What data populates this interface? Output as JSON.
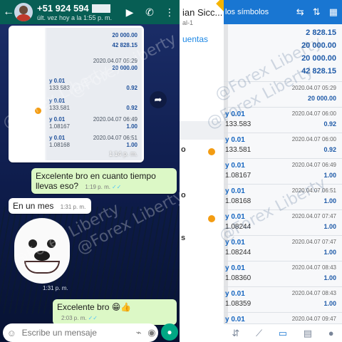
{
  "whatsapp": {
    "contact_name": "+51 924 594",
    "last_seen": "últ. vez hoy a la 1:55 p. m.",
    "image_message": {
      "lines": [
        {
          "top": "20 000.00"
        },
        {
          "top": "42 828.15"
        },
        {
          "top": "2020.04.07 05:29",
          "bottom": "20 000.00"
        },
        {
          "top": "y 0.01",
          "mid": "133.583",
          "right": "0.92"
        },
        {
          "top": "y 0.01",
          "mid": "133.581",
          "right": "0.92"
        },
        {
          "top": "y 0.01",
          "mid": "1.08167",
          "right": "2020.04.07 06:49",
          "right2": "1.00"
        },
        {
          "top": "y 0.01",
          "mid": "1.08168",
          "right": "2020.04.07 06:51",
          "right2": "1.00"
        }
      ],
      "time": "1:14 p. m."
    },
    "messages": [
      {
        "type": "out",
        "text": "Excelente bro en cuanto tiempo llevas eso?",
        "time": "1:19 p. m."
      },
      {
        "type": "in",
        "text": "En un mes",
        "time": "1:31 p. m."
      },
      {
        "type": "sticker_time",
        "time": "1:31 p. m."
      },
      {
        "type": "out",
        "text": "Excelente bro 😁👍",
        "time": "2:03 p. m."
      }
    ],
    "input_placeholder": "Escribe un mensaje"
  },
  "drawer": {
    "name": "ian Sicc...",
    "sub": "al-1",
    "link": "uentas",
    "letters": [
      "o",
      "s"
    ]
  },
  "mt4": {
    "title": "los símbolos",
    "summary": [
      "2 828.15",
      "20 000.00",
      "20 000.00",
      "42 828.15"
    ],
    "deposit": {
      "date": "2020.04.07 05:29",
      "amount": "20 000.00"
    },
    "trades": [
      {
        "sym": "y 0.01",
        "price": "133.583",
        "date": "2020.04.07 06:00",
        "pl": "0.92"
      },
      {
        "sym": "y 0.01",
        "price": "133.581",
        "date": "2020.04.07 06:00",
        "pl": "0.92"
      },
      {
        "sym": "y 0.01",
        "price": "1.08167",
        "date": "2020.04.07 06:49",
        "pl": "1.00"
      },
      {
        "sym": "y 0.01",
        "price": "1.08168",
        "date": "2020.04.07 06:51",
        "pl": "1.00"
      },
      {
        "sym": "y 0.01",
        "price": "1.08244",
        "date": "2020.04.07 07:47",
        "pl": "1.00"
      },
      {
        "sym": "y 0.01",
        "price": "1.08244",
        "date": "2020.04.07 07:47",
        "pl": "1.00"
      },
      {
        "sym": "y 0.01",
        "price": "1.08360",
        "date": "2020.04.07 08:43",
        "pl": "1.00"
      },
      {
        "sym": "y 0.01",
        "price": "1.08359",
        "date": "2020.04.07 08:43",
        "pl": "1.00"
      },
      {
        "sym": "y 0.01",
        "price": "",
        "date": "2020.04.07 09:47",
        "pl": ""
      }
    ]
  },
  "watermark": "@Forex Liberty"
}
